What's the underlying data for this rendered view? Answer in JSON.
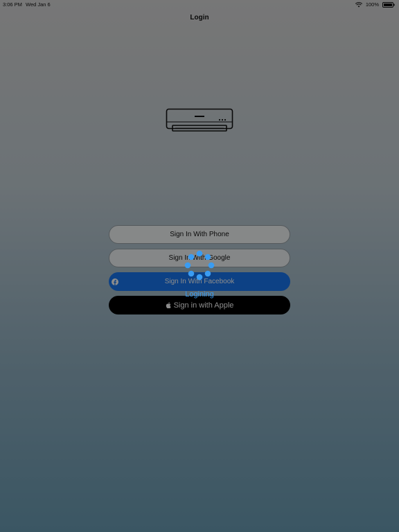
{
  "status_bar": {
    "time": "3:06 PM",
    "date": "Wed Jan 6",
    "battery": "100%"
  },
  "nav": {
    "title": "Login"
  },
  "icons": {
    "app_logo": "air-conditioner-icon",
    "facebook": "facebook-icon",
    "apple": "apple-icon",
    "wifi": "wifi-icon",
    "battery": "battery-icon",
    "spinner": "loading-spinner-icon"
  },
  "buttons": {
    "phone_label": "Sign In With Phone",
    "google_label": "Sign In With Google",
    "facebook_label": "Sign In With Facebook",
    "apple_label": "Sign in with Apple"
  },
  "loading": {
    "label": "Logining"
  },
  "colors": {
    "facebook": "#1877f2",
    "apple": "#000000",
    "spinner": "#3a9cf2"
  }
}
